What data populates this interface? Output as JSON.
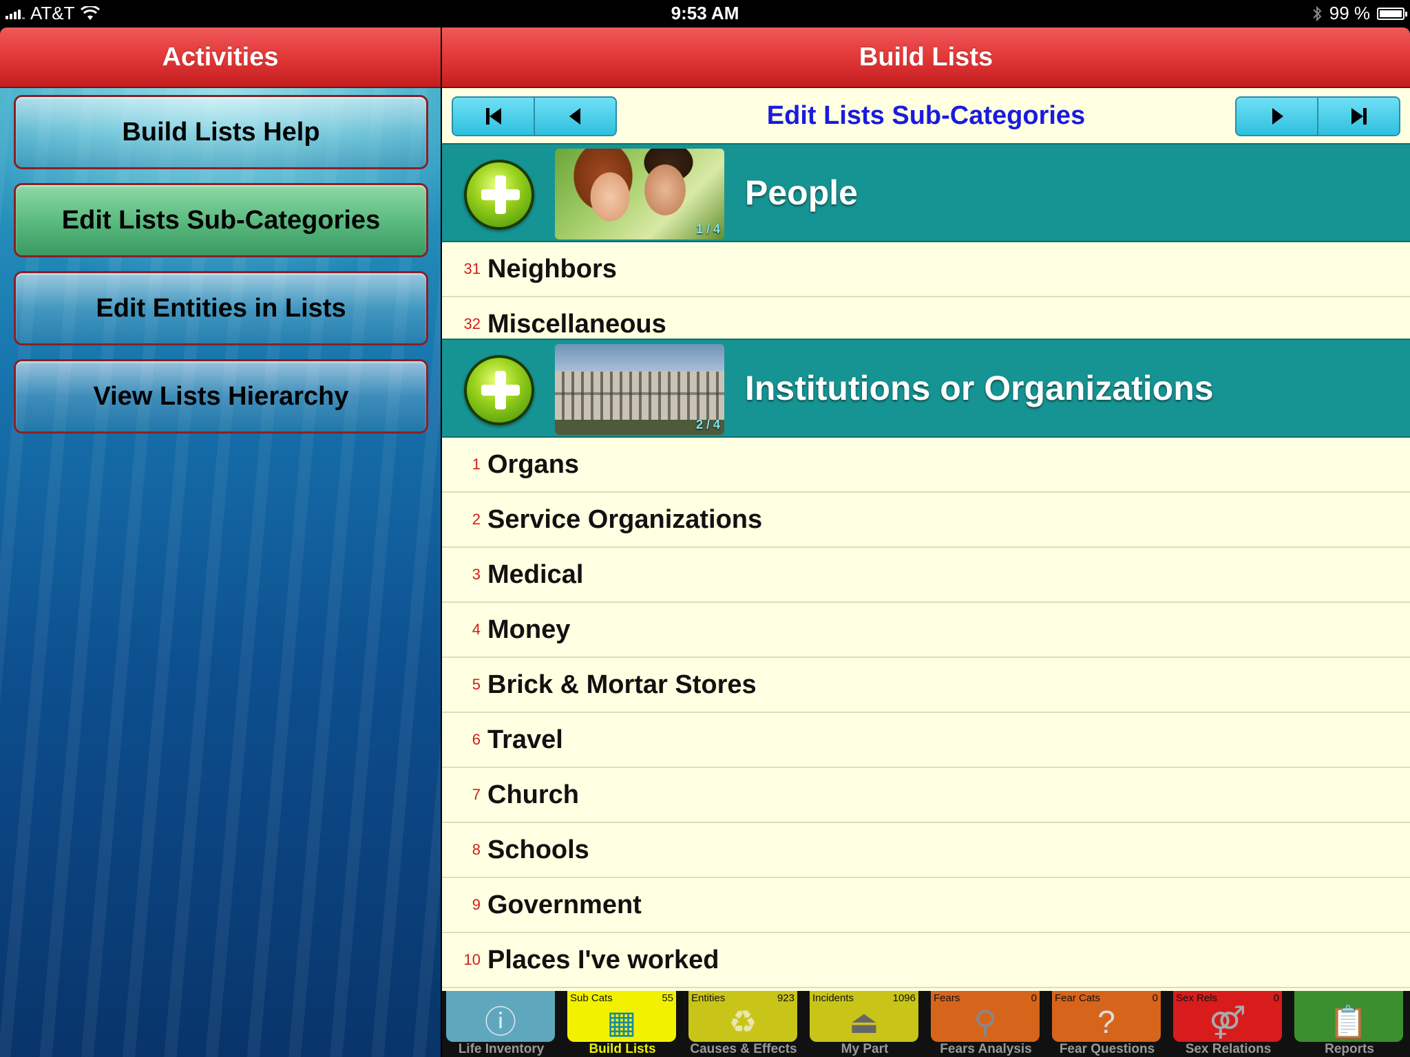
{
  "status_bar": {
    "carrier": "AT&T",
    "time": "9:53 AM",
    "battery": "99 %",
    "battery_level": 0.99
  },
  "left_panel": {
    "title": "Activities",
    "buttons": [
      {
        "label": "Build Lists Help",
        "selected": false
      },
      {
        "label": "Edit Lists Sub-Categories",
        "selected": true
      },
      {
        "label": "Edit Entities in Lists",
        "selected": false
      },
      {
        "label": "View Lists Hierarchy",
        "selected": false
      }
    ]
  },
  "main": {
    "title": "Build Lists",
    "nav_title": "Edit Lists Sub-Categories",
    "sections": [
      {
        "title": "People",
        "page": "1 / 4",
        "rows": [
          {
            "num": "31",
            "label": "Neighbors"
          },
          {
            "num": "32",
            "label": "Miscellaneous"
          }
        ]
      },
      {
        "title": "Institutions or Organizations",
        "page": "2 / 4",
        "rows": [
          {
            "num": "1",
            "label": "Organs"
          },
          {
            "num": "2",
            "label": "Service Organizations"
          },
          {
            "num": "3",
            "label": "Medical"
          },
          {
            "num": "4",
            "label": "Money"
          },
          {
            "num": "5",
            "label": "Brick & Mortar Stores"
          },
          {
            "num": "6",
            "label": "Travel"
          },
          {
            "num": "7",
            "label": "Church"
          },
          {
            "num": "8",
            "label": "Schools"
          },
          {
            "num": "9",
            "label": "Government"
          },
          {
            "num": "10",
            "label": "Places I've worked"
          }
        ]
      }
    ]
  },
  "tabs": [
    {
      "label": "Life Inventory",
      "count_label": "",
      "count": "",
      "color": "#5fa7bd",
      "icon": "info-icon",
      "active": false
    },
    {
      "label": "Build Lists",
      "count_label": "Sub Cats",
      "count": "55",
      "color": "#f2f200",
      "icon": "build-lists-icon",
      "active": true
    },
    {
      "label": "Causes & Effects",
      "count_label": "Entities",
      "count": "923",
      "color": "#c9c418",
      "icon": "recycle-icon",
      "active": false
    },
    {
      "label": "My Part",
      "count_label": "Incidents",
      "count": "1096",
      "color": "#c9c418",
      "icon": "joystick-icon",
      "active": false
    },
    {
      "label": "Fears Analysis",
      "count_label": "Fears",
      "count": "0",
      "color": "#d7641b",
      "icon": "magnifier-icon",
      "active": false
    },
    {
      "label": "Fear Questions",
      "count_label": "Fear Cats",
      "count": "0",
      "color": "#d7641b",
      "icon": "question-icon",
      "active": false
    },
    {
      "label": "Sex Relations",
      "count_label": "Sex Rels",
      "count": "0",
      "color": "#d81c1c",
      "icon": "gender-icon",
      "active": false
    },
    {
      "label": "Reports",
      "count_label": "",
      "count": "",
      "color": "#3c8f2e",
      "icon": "clipboard-icon",
      "active": false
    }
  ]
}
